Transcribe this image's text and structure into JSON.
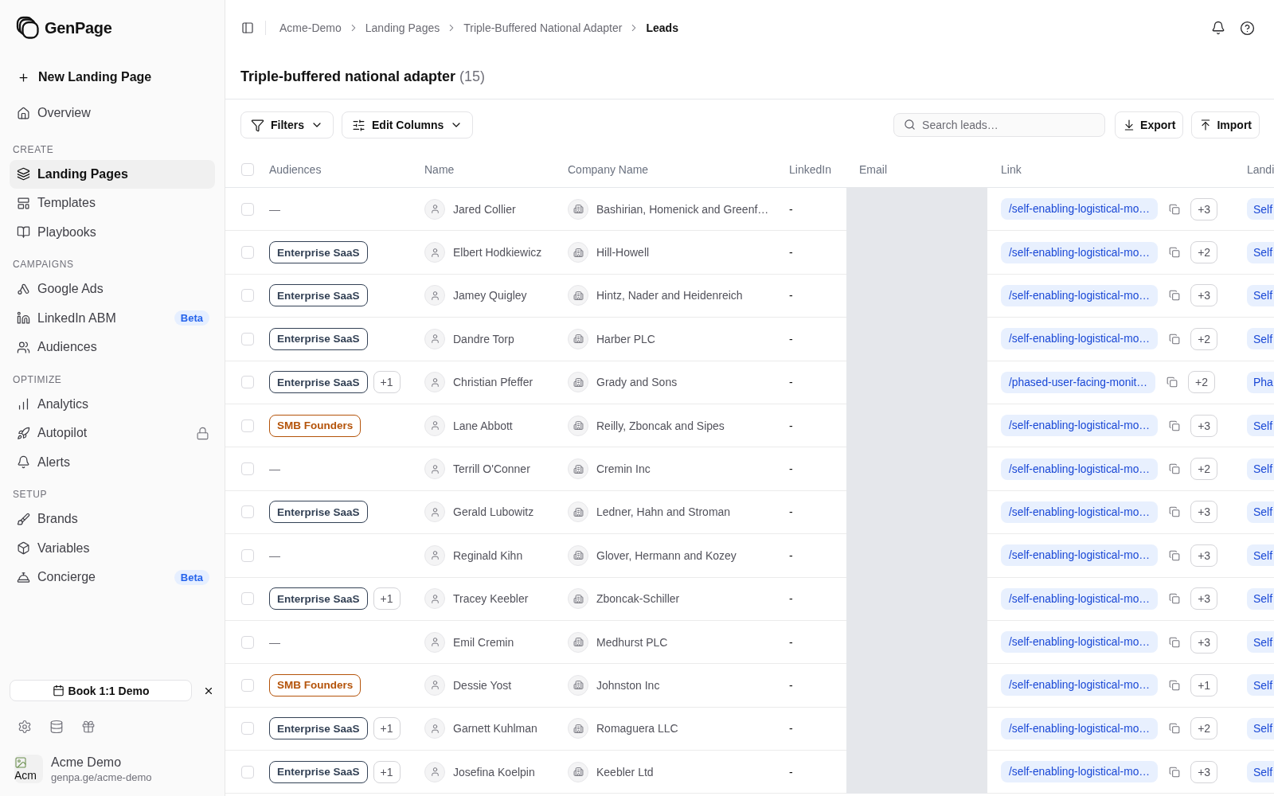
{
  "sidebar": {
    "brand": "GenPage",
    "new_button": "New Landing Page",
    "top_items": [
      {
        "label": "Overview",
        "selected": false,
        "locked": false
      }
    ],
    "sections": [
      {
        "title": "CREATE",
        "items": [
          {
            "label": "Landing Pages",
            "selected": true,
            "locked": false
          },
          {
            "label": "Templates",
            "selected": false,
            "locked": false
          },
          {
            "label": "Playbooks",
            "selected": false,
            "locked": false
          }
        ]
      },
      {
        "title": "CAMPAIGNS",
        "items": [
          {
            "label": "Google Ads",
            "selected": false,
            "locked": false
          },
          {
            "label": "LinkedIn ABM",
            "selected": false,
            "locked": false,
            "badge": "Beta"
          },
          {
            "label": "Audiences",
            "selected": false,
            "locked": false
          }
        ]
      },
      {
        "title": "OPTIMIZE",
        "items": [
          {
            "label": "Analytics",
            "selected": false,
            "locked": false
          },
          {
            "label": "Autopilot",
            "selected": false,
            "locked": true
          },
          {
            "label": "Alerts",
            "selected": false,
            "locked": false
          }
        ]
      },
      {
        "title": "SETUP",
        "items": [
          {
            "label": "Brands",
            "selected": false,
            "locked": false
          },
          {
            "label": "Variables",
            "selected": false,
            "locked": false
          },
          {
            "label": "Concierge",
            "selected": false,
            "locked": false,
            "badge": "Beta"
          }
        ]
      }
    ],
    "demo_button": "Book 1:1 Demo",
    "account": {
      "avatar_alt": "Acm",
      "name": "Acme Demo",
      "url": "genpa.ge/acme-demo"
    }
  },
  "breadcrumbs": [
    {
      "label": "Acme-Demo",
      "current": false
    },
    {
      "label": "Landing Pages",
      "current": false
    },
    {
      "label": "Triple-Buffered National Adapter",
      "current": false
    },
    {
      "label": "Leads",
      "current": true
    }
  ],
  "page": {
    "title": "Triple-buffered national adapter",
    "count": "(15)"
  },
  "toolbar": {
    "filters": "Filters",
    "edit_columns": "Edit Columns",
    "search": {
      "placeholder": "Search leads…"
    },
    "export": "Export",
    "import": "Import"
  },
  "table": {
    "all_selected": false,
    "columns": [
      "Audiences",
      "Name",
      "Company Name",
      "LinkedIn",
      "Email",
      "Link",
      "Landi"
    ],
    "rows": [
      {
        "selected": false,
        "audience": {
          "kind": "empty",
          "label": "—"
        },
        "name": "Jared Collier",
        "company": "Bashirian, Homenick and Greenf…",
        "linkedin": "-",
        "link": "/self-enabling-logistical-mo…",
        "link_more": "+3",
        "landing": "Self"
      },
      {
        "selected": false,
        "audience": {
          "kind": "tag",
          "label": "Enterprise SaaS",
          "color": "#334155"
        },
        "name": "Elbert Hodkiewicz",
        "company": "Hill-Howell",
        "linkedin": "-",
        "link": "/self-enabling-logistical-mo…",
        "link_more": "+2",
        "landing": "Self"
      },
      {
        "selected": false,
        "audience": {
          "kind": "tag",
          "label": "Enterprise SaaS",
          "color": "#334155"
        },
        "name": "Jamey Quigley",
        "company": "Hintz, Nader and Heidenreich",
        "linkedin": "-",
        "link": "/self-enabling-logistical-mo…",
        "link_more": "+3",
        "landing": "Self"
      },
      {
        "selected": false,
        "audience": {
          "kind": "tag",
          "label": "Enterprise SaaS",
          "color": "#334155"
        },
        "name": "Dandre Torp",
        "company": "Harber PLC",
        "linkedin": "-",
        "link": "/self-enabling-logistical-mo…",
        "link_more": "+2",
        "landing": "Self"
      },
      {
        "selected": false,
        "audience": {
          "kind": "tag",
          "label": "Enterprise SaaS",
          "color": "#334155"
        },
        "audience_more": "+1",
        "name": "Christian Pfeffer",
        "company": "Grady and Sons",
        "linkedin": "-",
        "link": "/phased-user-facing-monit…",
        "link_more": "+2",
        "landing": "Pha"
      },
      {
        "selected": false,
        "audience": {
          "kind": "tag",
          "label": "SMB Founders",
          "color": "#b45309"
        },
        "name": "Lane Abbott",
        "company": "Reilly, Zboncak and Sipes",
        "linkedin": "-",
        "link": "/self-enabling-logistical-mo…",
        "link_more": "+3",
        "landing": "Self"
      },
      {
        "selected": false,
        "audience": {
          "kind": "empty",
          "label": "—"
        },
        "name": "Terrill O'Conner",
        "company": "Cremin Inc",
        "linkedin": "-",
        "link": "/self-enabling-logistical-mo…",
        "link_more": "+2",
        "landing": "Self"
      },
      {
        "selected": false,
        "audience": {
          "kind": "tag",
          "label": "Enterprise SaaS",
          "color": "#334155"
        },
        "name": "Gerald Lubowitz",
        "company": "Ledner, Hahn and Stroman",
        "linkedin": "-",
        "link": "/self-enabling-logistical-mo…",
        "link_more": "+3",
        "landing": "Self"
      },
      {
        "selected": false,
        "audience": {
          "kind": "empty",
          "label": "—"
        },
        "name": "Reginald Kihn",
        "company": "Glover, Hermann and Kozey",
        "linkedin": "-",
        "link": "/self-enabling-logistical-mo…",
        "link_more": "+3",
        "landing": "Self"
      },
      {
        "selected": false,
        "audience": {
          "kind": "tag",
          "label": "Enterprise SaaS",
          "color": "#334155"
        },
        "audience_more": "+1",
        "name": "Tracey Keebler",
        "company": "Zboncak-Schiller",
        "linkedin": "-",
        "link": "/self-enabling-logistical-mo…",
        "link_more": "+3",
        "landing": "Self"
      },
      {
        "selected": false,
        "audience": {
          "kind": "empty",
          "label": "—"
        },
        "name": "Emil Cremin",
        "company": "Medhurst PLC",
        "linkedin": "-",
        "link": "/self-enabling-logistical-mo…",
        "link_more": "+3",
        "landing": "Self"
      },
      {
        "selected": false,
        "audience": {
          "kind": "tag",
          "label": "SMB Founders",
          "color": "#b45309"
        },
        "name": "Dessie Yost",
        "company": "Johnston Inc",
        "linkedin": "-",
        "link": "/self-enabling-logistical-mo…",
        "link_more": "+1",
        "landing": "Self"
      },
      {
        "selected": false,
        "audience": {
          "kind": "tag",
          "label": "Enterprise SaaS",
          "color": "#334155"
        },
        "audience_more": "+1",
        "name": "Garnett Kuhlman",
        "company": "Romaguera LLC",
        "linkedin": "-",
        "link": "/self-enabling-logistical-mo…",
        "link_more": "+2",
        "landing": "Self"
      },
      {
        "selected": false,
        "audience": {
          "kind": "tag",
          "label": "Enterprise SaaS",
          "color": "#334155"
        },
        "audience_more": "+1",
        "name": "Josefina Koelpin",
        "company": "Keebler Ltd",
        "linkedin": "-",
        "link": "/self-enabling-logistical-mo…",
        "link_more": "+3",
        "landing": "Self"
      }
    ]
  }
}
